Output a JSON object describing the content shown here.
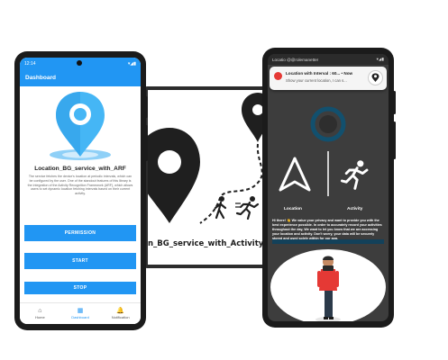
{
  "left_phone": {
    "status_time": "12:14",
    "status_icons": "▾◢▮",
    "appbar_title": "Dashboard",
    "app_title": "Location_BG_service_with_ARF",
    "description": "The service fetches the device's location at periodic intervals, which can be configured by the user. One of the standout features of this library is the integration of the Activity Recognition Framework (ARF), which allows users to set dynamic location fetching intervals based on their current activity.",
    "buttons": [
      "PERMISSION",
      "START",
      "STOP"
    ],
    "nav_items": [
      {
        "label": "Home",
        "icon": "home-icon"
      },
      {
        "label": "Dashboard",
        "icon": "dashboard-icon"
      },
      {
        "label": "Notification",
        "icon": "bell-icon"
      }
    ],
    "accent_color": "#2196f3"
  },
  "banner": {
    "text": "n_BG_service_with_Activity_Rec"
  },
  "right_phone": {
    "status_left": "Locatio @@rolemanetter",
    "status_right": "▾◢▮",
    "notification": {
      "title": "Location with Interval : 60...  •  Now",
      "body": "Show your current location, I can s..."
    },
    "features": [
      {
        "label": "Location",
        "icon": "navigation-arrow-icon"
      },
      {
        "label": "Activity",
        "icon": "running-person-icon"
      }
    ],
    "privacy_text": "Hi there! 👋 We value your privacy and want to provide you with the best experience possible. In order to accurately record your activities throughout the day, We want to let you know that we are accessing your location and activity. Don't worry, your data will be securely stored and used solely within for our app.",
    "dark_bg": "#3d3d3d"
  }
}
